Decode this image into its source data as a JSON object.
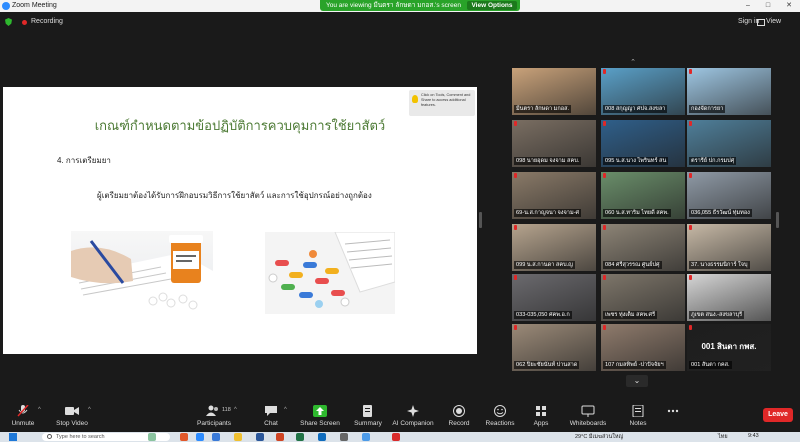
{
  "window": {
    "title": "Zoom Meeting"
  },
  "banner": {
    "message": "You are viewing มีนตรา ลักษดา มกอส.'s screen",
    "button": "View Options"
  },
  "header": {
    "recording": "Recording",
    "sign_in": "Sign in",
    "view": "View"
  },
  "slide": {
    "title": "เกณฑ์กำหนดตามข้อปฏิบัติการควบคุมการใช้ยาสัตว์",
    "heading": "4. การเตรียมยา",
    "body": "ผู้เตรียมยาต้องได้รับการฝึกอบรมวิธีการใช้ยาสัตว์ และการใช้อุปกรณ์อย่างถูกต้อง",
    "tooltip": "Click on Tools, Comment and Share to access additional features."
  },
  "gallery": {
    "tiles": [
      {
        "name": "มีนตรา ลักษดา มกอส.",
        "color": "#c9a27a",
        "active": true,
        "muted": false
      },
      {
        "name": "008 สกุญญา ศปจ.สงขลา",
        "color": "#5aa0c8",
        "active": false,
        "muted": true
      },
      {
        "name": "กองจัดการยา",
        "color": "#9ec6e2",
        "active": false,
        "muted": true
      },
      {
        "name": "098 นายอุดม จงจาม สคบ.",
        "color": "#7a6e62",
        "active": false,
        "muted": true
      },
      {
        "name": "095 น.ส.นาง ไพรินทร์ สน",
        "color": "#2f5f8a",
        "active": false,
        "muted": true
      },
      {
        "name": "ตรารีย์ ปก.กรมปศุ",
        "color": "#4f7f9a",
        "active": false,
        "muted": true
      },
      {
        "name": "69-น.ส.กาญจนา จงจาม-ศ",
        "color": "#8a7a68",
        "active": false,
        "muted": true
      },
      {
        "name": "060 น.ส.ทาริ่ม ไทยดี สคพ.",
        "color": "#6a8e6a",
        "active": false,
        "muted": true
      },
      {
        "name": "036,055 ธีรวัฒน์ ทุ่มทอง",
        "color": "#8f9aa6",
        "active": false,
        "muted": true
      },
      {
        "name": "099 น.ส.กานดา สคบ.ญ",
        "color": "#b6a48e",
        "active": false,
        "muted": true
      },
      {
        "name": "084 ศรีสุวรรณ ศูนย์ปศุ",
        "color": "#8d8476",
        "active": false,
        "muted": true
      },
      {
        "name": "37. นางธรรมนิการ์ ใจบุ",
        "color": "#c7b9a6",
        "active": false,
        "muted": true
      },
      {
        "name": "033-035,050 ศคพ.อ.ก",
        "color": "#6b6a6e",
        "active": false,
        "muted": true
      },
      {
        "name": "เพชร ทุ่งเต็ม สคพ.ศรี",
        "color": "#7e766a",
        "active": false,
        "muted": true
      },
      {
        "name": "ภูเขต สนง.-สงขลาบุรี",
        "color": "#d6d6d6",
        "active": false,
        "muted": true
      },
      {
        "name": "062 ปิยะชัยนันท์ ปานสาด",
        "color": "#9b8a78",
        "active": false,
        "muted": true
      },
      {
        "name": "107 กมลทิพย์ -ปาปัจจัยฯ",
        "color": "#8f7b6c",
        "active": false,
        "muted": true
      },
      {
        "name": "001 สันตา กคส.",
        "color": "#1e1e1e",
        "active": false,
        "muted": true,
        "big": "001 สินดา กพส."
      }
    ]
  },
  "toolbar": {
    "unmute": "Unmute",
    "stop_video": "Stop Video",
    "participants": "Participants",
    "participant_count": "118",
    "chat": "Chat",
    "share": "Share Screen",
    "summary": "Summary",
    "ai": "AI Companion",
    "record": "Record",
    "reactions": "Reactions",
    "apps": "Apps",
    "whiteboards": "Whiteboards",
    "notes": "Notes",
    "leave": "Leave"
  },
  "taskbar": {
    "search_placeholder": "Type here to search",
    "weather": "29°C มีเมฆส่วนใหญ่",
    "time": "9:43",
    "lang": "ไทย"
  },
  "colors": {
    "accent_green": "#29a329",
    "record_red": "#e02828",
    "slide_title_green": "#4c7a34",
    "active_speaker": "#f2cf00"
  }
}
